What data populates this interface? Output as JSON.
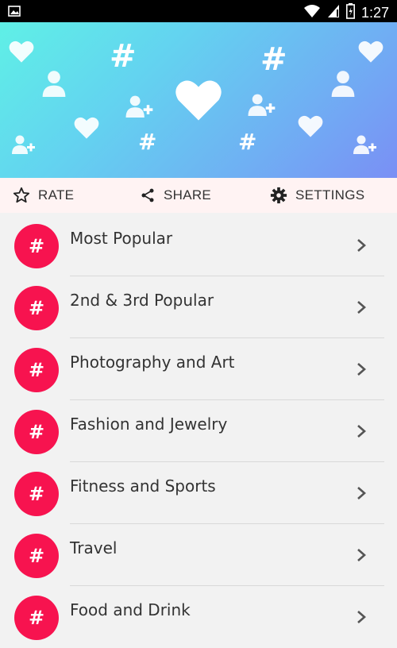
{
  "status_bar": {
    "time": "1:27",
    "icons": [
      "image-icon",
      "wifi-icon",
      "signal-icon",
      "battery-icon"
    ]
  },
  "banner": {
    "colors": {
      "start": "#5ff0e6",
      "end": "#7a8ff5"
    },
    "decorations": [
      "heart-icon",
      "hashtag-icon",
      "person-icon",
      "person-add-icon"
    ]
  },
  "toolbar": {
    "rate_label": "RATE",
    "share_label": "SHARE",
    "settings_label": "SETTINGS"
  },
  "categories": [
    {
      "badge": "#",
      "label": "Most Popular"
    },
    {
      "badge": "#",
      "label": "2nd & 3rd Popular"
    },
    {
      "badge": "#",
      "label": "Photography and Art"
    },
    {
      "badge": "#",
      "label": "Fashion and Jewelry"
    },
    {
      "badge": "#",
      "label": "Fitness and Sports"
    },
    {
      "badge": "#",
      "label": "Travel"
    },
    {
      "badge": "#",
      "label": "Food and Drink"
    }
  ],
  "accent_color": "#f7134f"
}
